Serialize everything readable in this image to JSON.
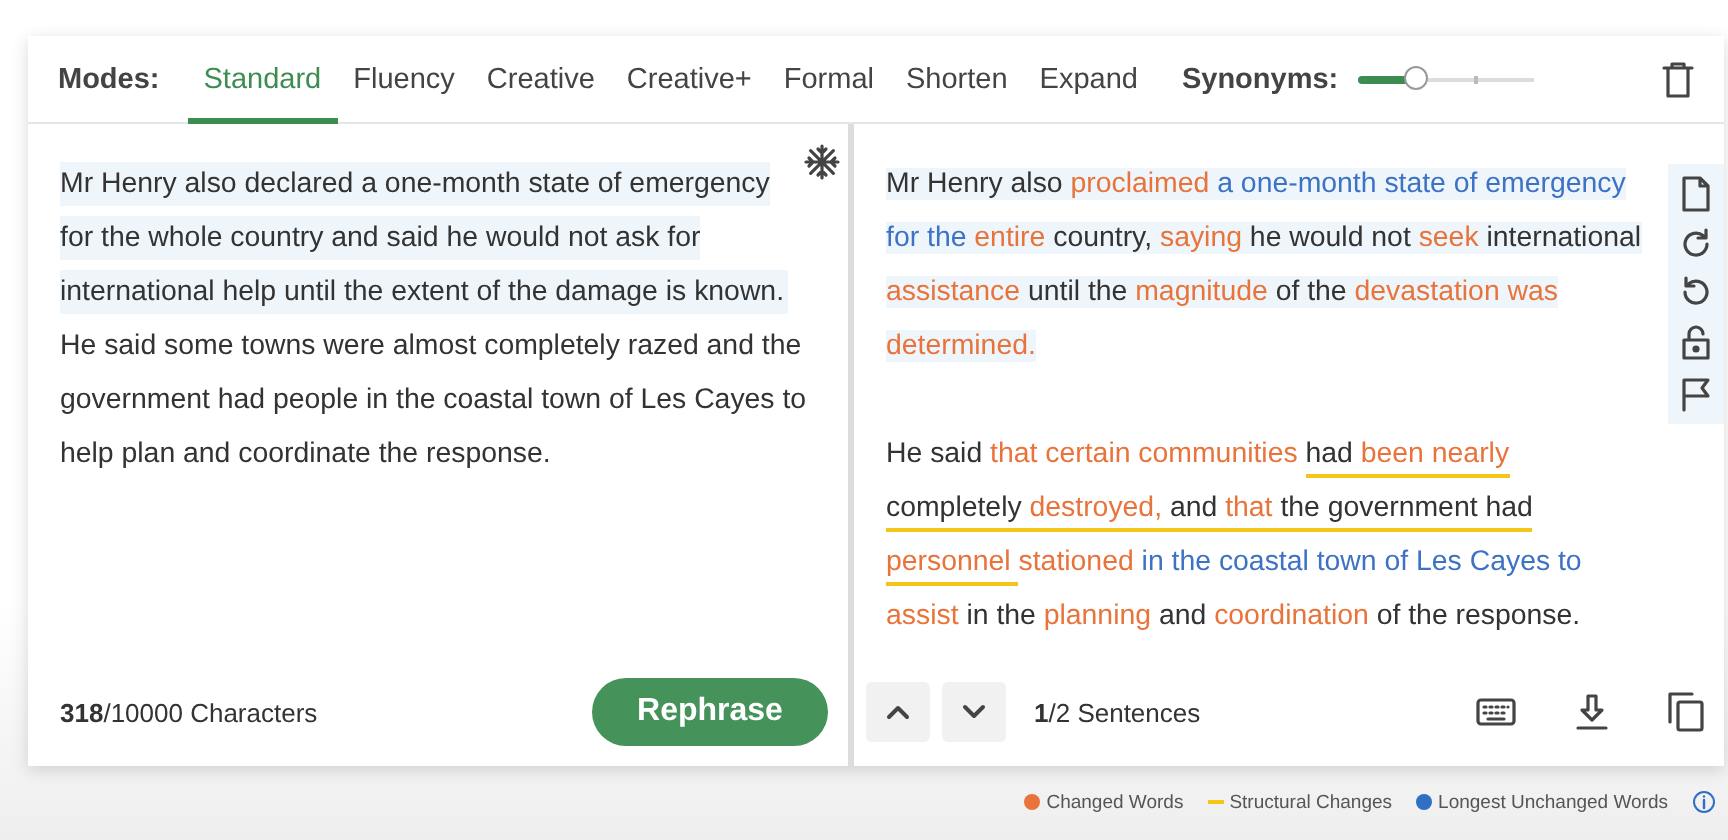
{
  "modes": {
    "label": "Modes:",
    "tabs": [
      {
        "label": "Standard",
        "selected": true
      },
      {
        "label": "Fluency",
        "selected": false
      },
      {
        "label": "Creative",
        "selected": false
      },
      {
        "label": "Creative+",
        "selected": false
      },
      {
        "label": "Formal",
        "selected": false
      },
      {
        "label": "Shorten",
        "selected": false
      },
      {
        "label": "Expand",
        "selected": false
      }
    ]
  },
  "synonyms": {
    "label": "Synonyms:",
    "level": 0.33
  },
  "input": {
    "sentences": [
      {
        "text": "Mr Henry also declared a one-month state of emergency for the whole country and said he would not ask for international help until the extent of the damage is known.",
        "highlighted": true
      },
      {
        "text": "He said some towns were almost completely razed and the government had people in the coastal town of Les Cayes to help plan and coordinate the response.",
        "highlighted": false
      }
    ],
    "char_count": "**318**/10000 Characters",
    "button": "Rephrase"
  },
  "output": {
    "paragraphs": [
      {
        "highlighted": true,
        "segments": [
          {
            "text": "Mr Henry also ",
            "kind": "plain",
            "structural": false
          },
          {
            "text": "proclaimed ",
            "kind": "changed",
            "structural": false
          },
          {
            "text": "a one-month state of emergency for the ",
            "kind": "unchanged",
            "structural": false
          },
          {
            "text": "entire",
            "kind": "changed",
            "structural": false
          },
          {
            "text": " country, ",
            "kind": "plain",
            "structural": false
          },
          {
            "text": "saying",
            "kind": "changed",
            "structural": false
          },
          {
            "text": " he would not ",
            "kind": "plain",
            "structural": false
          },
          {
            "text": "seek",
            "kind": "changed",
            "structural": false
          },
          {
            "text": " international ",
            "kind": "plain",
            "structural": false
          },
          {
            "text": "assistance",
            "kind": "changed",
            "structural": false
          },
          {
            "text": " until the ",
            "kind": "plain",
            "structural": false
          },
          {
            "text": "magnitude",
            "kind": "changed",
            "structural": false
          },
          {
            "text": " of the ",
            "kind": "plain",
            "structural": false
          },
          {
            "text": "devastation was determined.",
            "kind": "changed",
            "structural": false
          }
        ]
      },
      {
        "highlighted": false,
        "segments": [
          {
            "text": "He said ",
            "kind": "plain",
            "structural": false
          },
          {
            "text": "that certain communities ",
            "kind": "changed",
            "structural": false
          },
          {
            "text": "had ",
            "kind": "plain",
            "structural": true
          },
          {
            "text": "been nearly",
            "kind": "changed",
            "structural": true
          },
          {
            "text": " completely ",
            "kind": "plain",
            "structural": true
          },
          {
            "text": "destroyed,",
            "kind": "changed",
            "structural": true
          },
          {
            "text": " and ",
            "kind": "plain",
            "structural": true
          },
          {
            "text": "that",
            "kind": "changed",
            "structural": true
          },
          {
            "text": " the government had ",
            "kind": "plain",
            "structural": true
          },
          {
            "text": "personnel ",
            "kind": "changed",
            "structural": true
          },
          {
            "text": "stationed ",
            "kind": "changed",
            "structural": false
          },
          {
            "text": "in the coastal town of Les Cayes to ",
            "kind": "unchanged",
            "structural": false
          },
          {
            "text": "assist",
            "kind": "changed",
            "structural": false
          },
          {
            "text": " in the ",
            "kind": "plain",
            "structural": false
          },
          {
            "text": "planning",
            "kind": "changed",
            "structural": false
          },
          {
            "text": " and ",
            "kind": "plain",
            "structural": false
          },
          {
            "text": "coordination",
            "kind": "changed",
            "structural": false
          },
          {
            "text": " of the response.",
            "kind": "plain",
            "structural": false
          }
        ]
      }
    ],
    "sentence_count": "**1**/2 Sentences"
  },
  "legend": [
    {
      "label": "Changed Words",
      "kind": "dot",
      "color": "#e8743b"
    },
    {
      "label": "Structural Changes",
      "kind": "line",
      "color": "#f5c518"
    },
    {
      "label": "Longest Unchanged Words",
      "kind": "dot",
      "color": "#2f6fc4"
    }
  ]
}
